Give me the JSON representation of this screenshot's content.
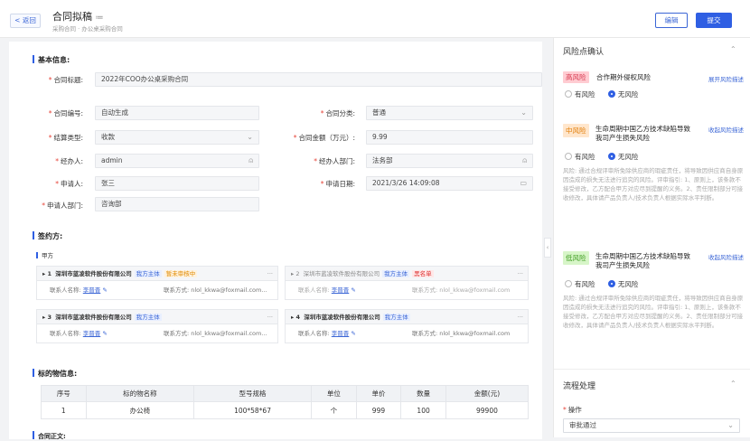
{
  "header": {
    "back": "< 返回",
    "title": "合同拟稿",
    "title_icon": "list-icon",
    "breadcrumb": "采购合同 · 办公桌采购合同",
    "edit": "编辑",
    "submit": "提交"
  },
  "basic": {
    "heading": "基本信息:",
    "title_label": "合同标题:",
    "title_value": "2022年COO办公桌采购合同",
    "no_label": "合同编号:",
    "no_value": "自动生成",
    "type_label": "合同分类:",
    "type_value": "普通",
    "settle_label": "结算类型:",
    "settle_value": "收款",
    "amount_label": "合同金额（万元）:",
    "amount_value": "9.99",
    "handler_label": "经办人:",
    "handler_value": "admin",
    "dept_label": "经办人部门:",
    "dept_value": "法务部",
    "applicant_label": "申请人:",
    "applicant_value": "张三",
    "date_label": "申请日期:",
    "date_value": "2021/3/26 14:09:08",
    "appdept_label": "申请人部门:",
    "appdept_value": "咨询部"
  },
  "parties": {
    "heading": "签约方:",
    "sub": "甲方",
    "cards": [
      {
        "num": "▸ 1",
        "name": "深圳市蓝凌软件股份有限公司",
        "tag1": "我方主体",
        "tag2": "暂未审核中",
        "contact_label": "联系人名称:",
        "contact": "李晋晋",
        "phone": "联系方式: nlol_kkwa@foxmail.com..."
      },
      {
        "num": "▸ 2",
        "name": "深圳市蓝凌软件股份有限公司",
        "tag1": "我方主体",
        "tag2": "黑名单",
        "contact_label": "联系人名称:",
        "contact": "李晋晋",
        "phone": "联系方式: nlol_kkwa@foxmail.com"
      },
      {
        "num": "▸ 3",
        "name": "深圳市蓝凌软件股份有限公司",
        "tag1": "我方主体",
        "tag2": "",
        "contact_label": "联系人名称:",
        "contact": "李晋晋",
        "phone": "联系方式: nlol_kkwa@foxmail.com..."
      },
      {
        "num": "▸ 4",
        "name": "深圳市蓝凌软件股份有限公司",
        "tag1": "我方主体",
        "tag2": "",
        "contact_label": "联系人名称:",
        "contact": "李晋晋",
        "phone": "联系方式: nlol_kkwa@foxmail.com"
      }
    ]
  },
  "items": {
    "heading": "标的物信息:",
    "cols": [
      "序号",
      "标的物名称",
      "型号规格",
      "单位",
      "单价",
      "数量",
      "金额(元)"
    ],
    "rows": [
      [
        "1",
        "办公椅",
        "100*58*67",
        "个",
        "999",
        "100",
        "99900"
      ]
    ]
  },
  "cut_heading": "合同正文:",
  "right": {
    "risk_title": "风险点确认",
    "flow_title": "流程处理",
    "risks": [
      {
        "level": "高风险",
        "name": "合作期外侵权风险",
        "link": "展开风险描述",
        "opt1": "有风险",
        "opt2": "无风险",
        "desc": ""
      },
      {
        "level": "中风险",
        "name": "生命周期中国乙方技术缺陷导致我司产生损失风险",
        "link": "收起风险描述",
        "opt1": "有风险",
        "opt2": "无风险",
        "desc": "风险: 通过合规评审所免除供应商的瑕疵责任，将导致因供应商自身原因造成的损失无法进行追究的风险。评审指引: 1、原则上，该条款不接受修改，乙方配合甲方对应尽到提醒的义务。2、责任限制部分可接收修改，具体请产品负责人/技术负责人根据实际水平判断。"
      },
      {
        "level": "低风险",
        "name": "生命周期中国乙方技术缺陷导致我司产生损失风险",
        "link": "收起风险描述",
        "opt1": "有风险",
        "opt2": "无风险",
        "desc": "风险: 通过合规评审所免除供应商的瑕疵责任，将导致因供应商自身原因造成的损失无法进行追究的风险。评审指引: 1、原则上，该条款不接受修改，乙方配合甲方对应尽到提醒的义务。2、责任限制部分可接收修改，具体请产品负责人/技术负责人根据实际水平判断。"
      }
    ],
    "op_label": "操作",
    "op_value": "审批通过"
  },
  "colors": {
    "accent": "#2f5fe3",
    "high": "#ffccd2",
    "mid": "#ffe6cc",
    "low": "#d7f5c8"
  }
}
